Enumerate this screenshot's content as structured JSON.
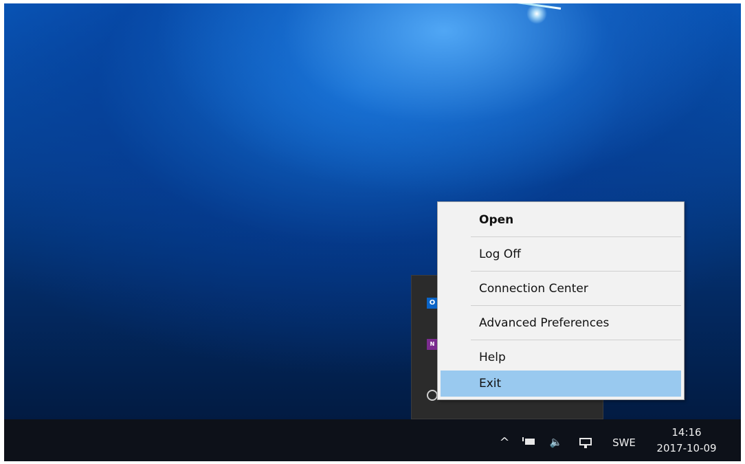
{
  "context_menu": {
    "items": [
      {
        "label": "Open",
        "bold": true
      },
      {
        "label": "Log Off"
      },
      {
        "label": "Connection Center"
      },
      {
        "label": "Advanced Preferences"
      },
      {
        "label": "Help"
      },
      {
        "label": "Exit",
        "highlighted": true
      }
    ],
    "highlight_color": "#99c9ef"
  },
  "flyout": {
    "icons": [
      "outlook-icon",
      "onenote-icon",
      "circle-app-icon",
      "dotted-app-icon",
      "gray-dot-icon"
    ],
    "outlook_glyph": "O",
    "onenote_glyph": "N"
  },
  "taskbar": {
    "chevron_glyph": "^",
    "volume_glyph": "🔈",
    "language": "SWE",
    "time": "14:16",
    "date": "2017-10-09"
  }
}
